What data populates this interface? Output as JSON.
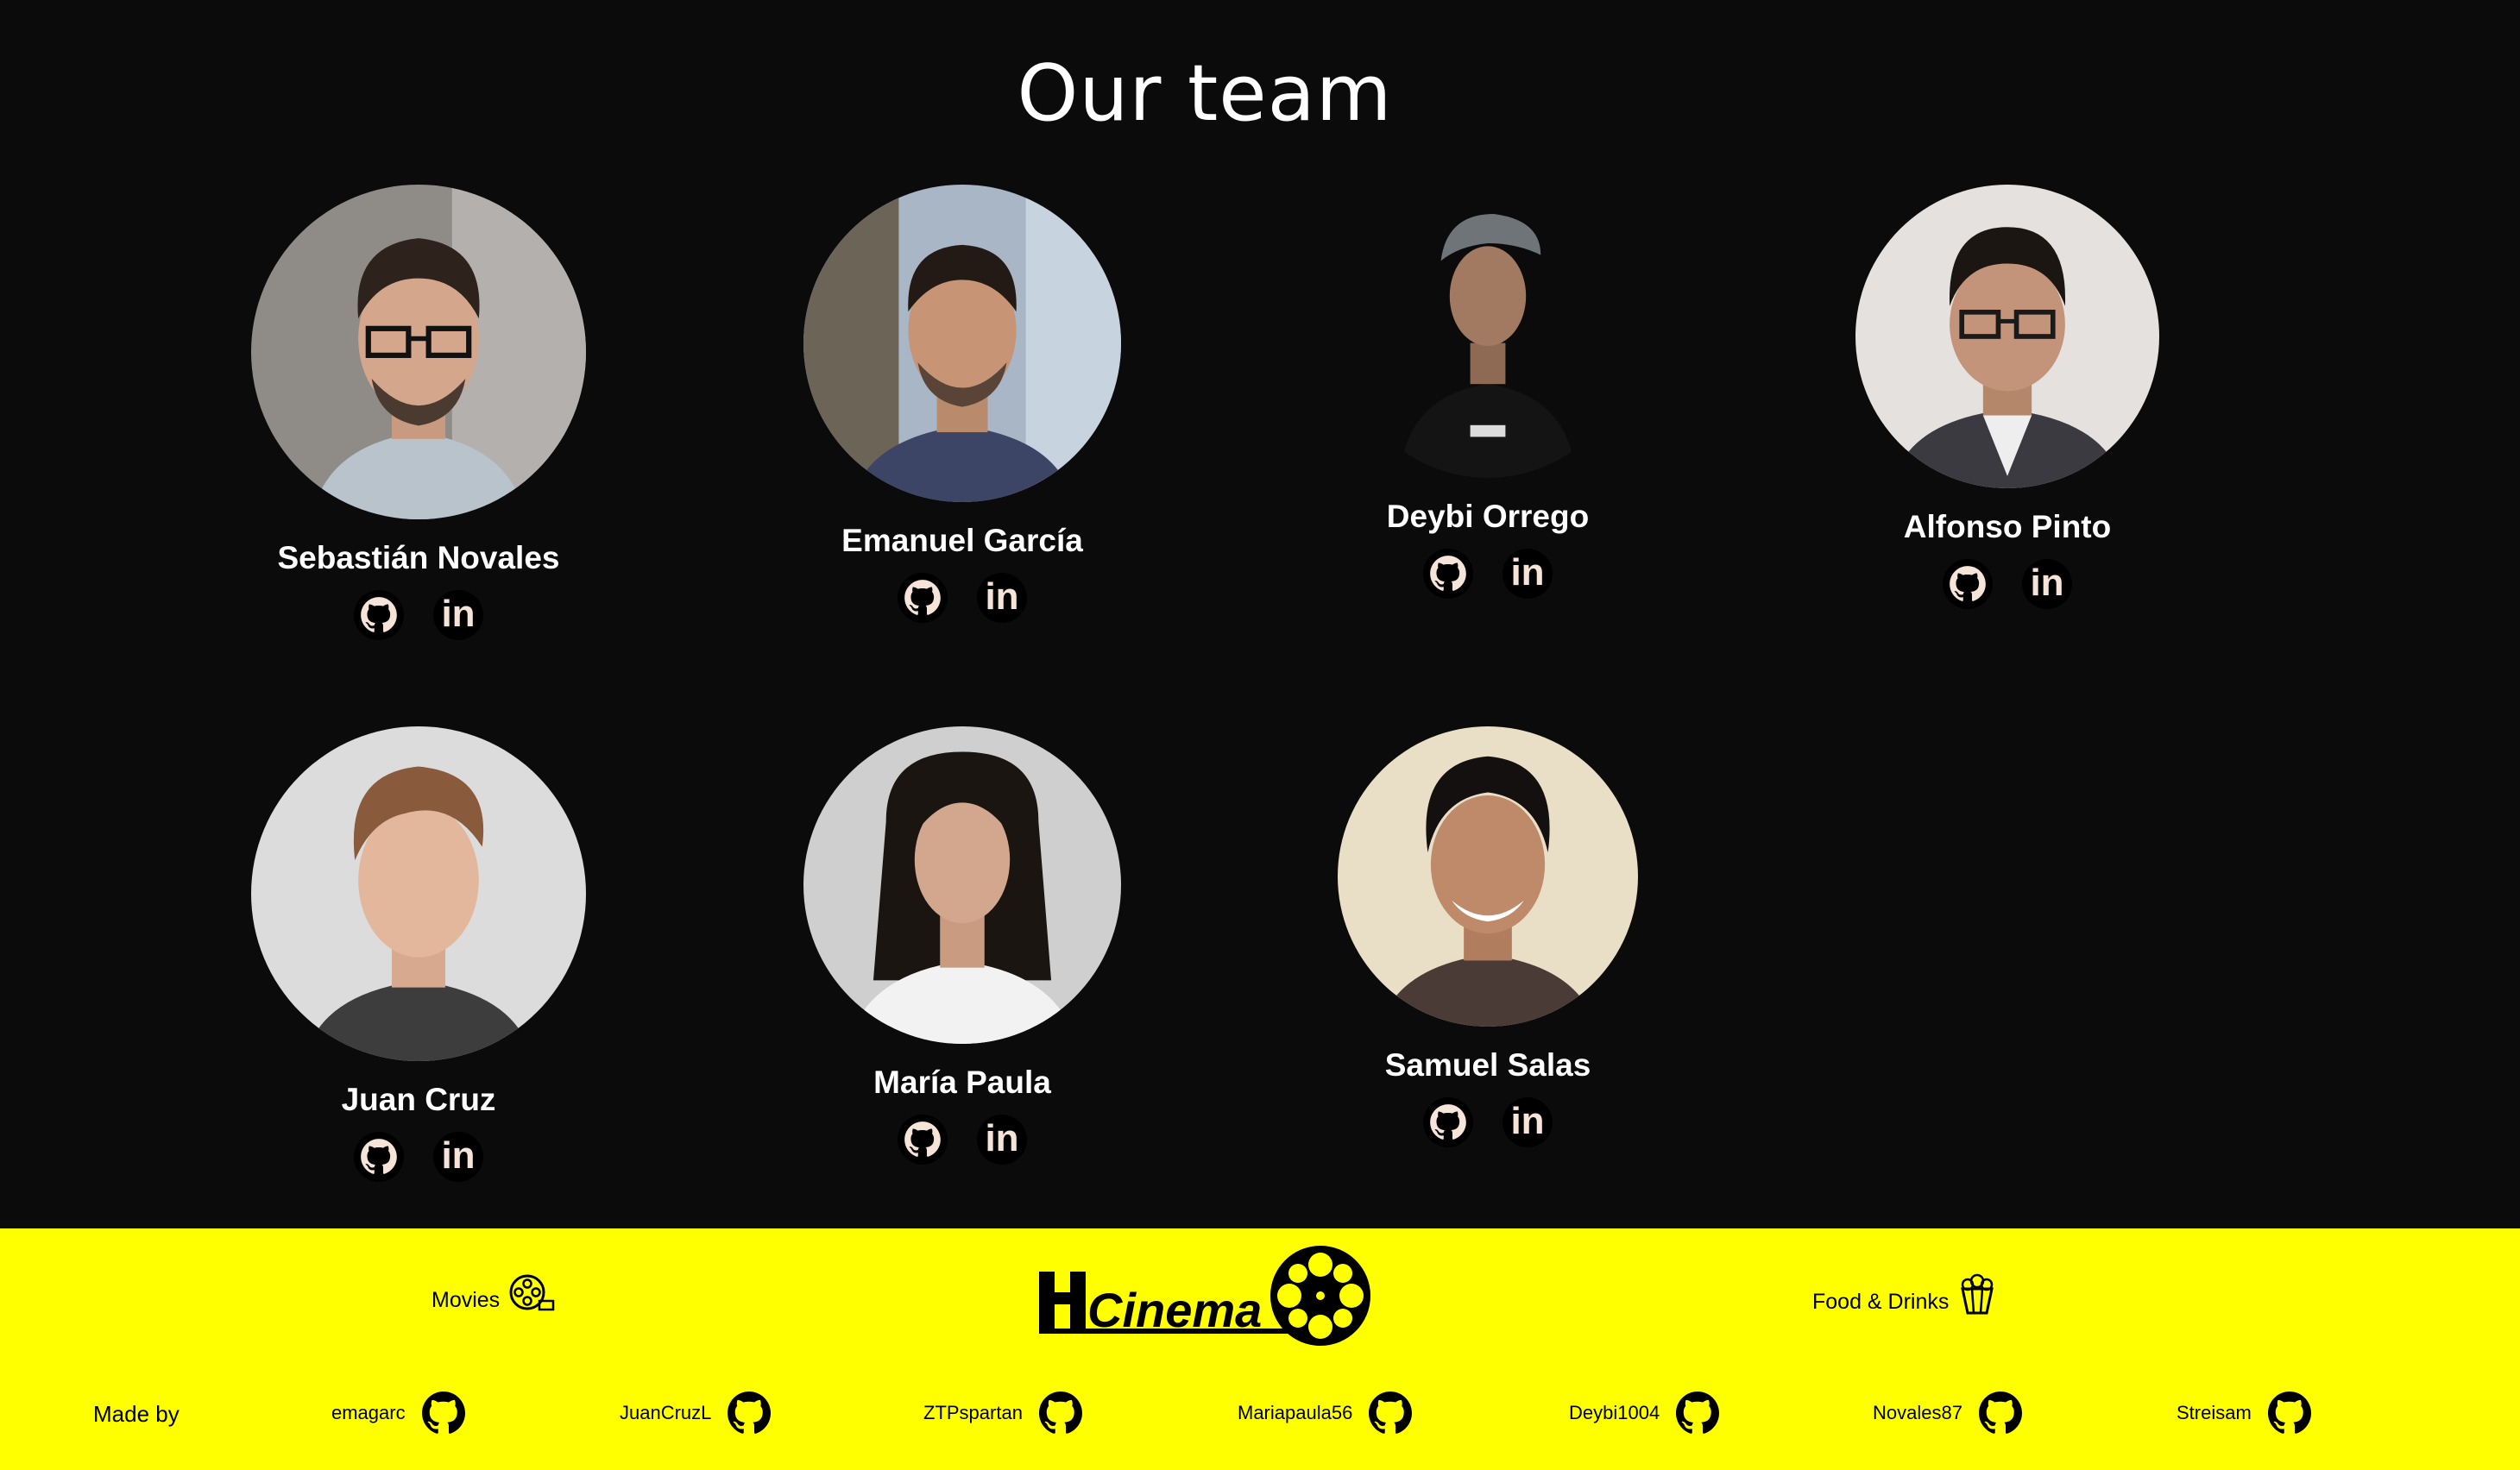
{
  "page": {
    "title": "Our team"
  },
  "team": [
    {
      "name": "Sebastián Novales",
      "linkedin_label": "in"
    },
    {
      "name": "Emanuel García",
      "linkedin_label": "in"
    },
    {
      "name": "Deybi Orrego",
      "linkedin_label": "in"
    },
    {
      "name": "Alfonso Pinto",
      "linkedin_label": "in"
    },
    {
      "name": "Juan Cruz",
      "linkedin_label": "in"
    },
    {
      "name": "María Paula",
      "linkedin_label": "in"
    },
    {
      "name": "Samuel Salas",
      "linkedin_label": "in"
    }
  ],
  "footer": {
    "nav": {
      "movies_label": "Movies",
      "food_label": "Food & Drinks"
    },
    "logo_text": "Cinema",
    "made_by_label": "Made by",
    "contributors": [
      "emagarc",
      "JuanCruzL",
      "ZTPspartan",
      "Mariapaula56",
      "Deybi1004",
      "Novales87",
      "Streisam"
    ]
  },
  "colors": {
    "background": "#0b0b0b",
    "footer": "#ffff00",
    "text": "#ffffff",
    "icon_fg": "#f6e4d8"
  },
  "icons": {
    "github": "github-icon",
    "linkedin": "linkedin-icon",
    "movies": "film-reel-icon",
    "food": "popcorn-icon"
  }
}
